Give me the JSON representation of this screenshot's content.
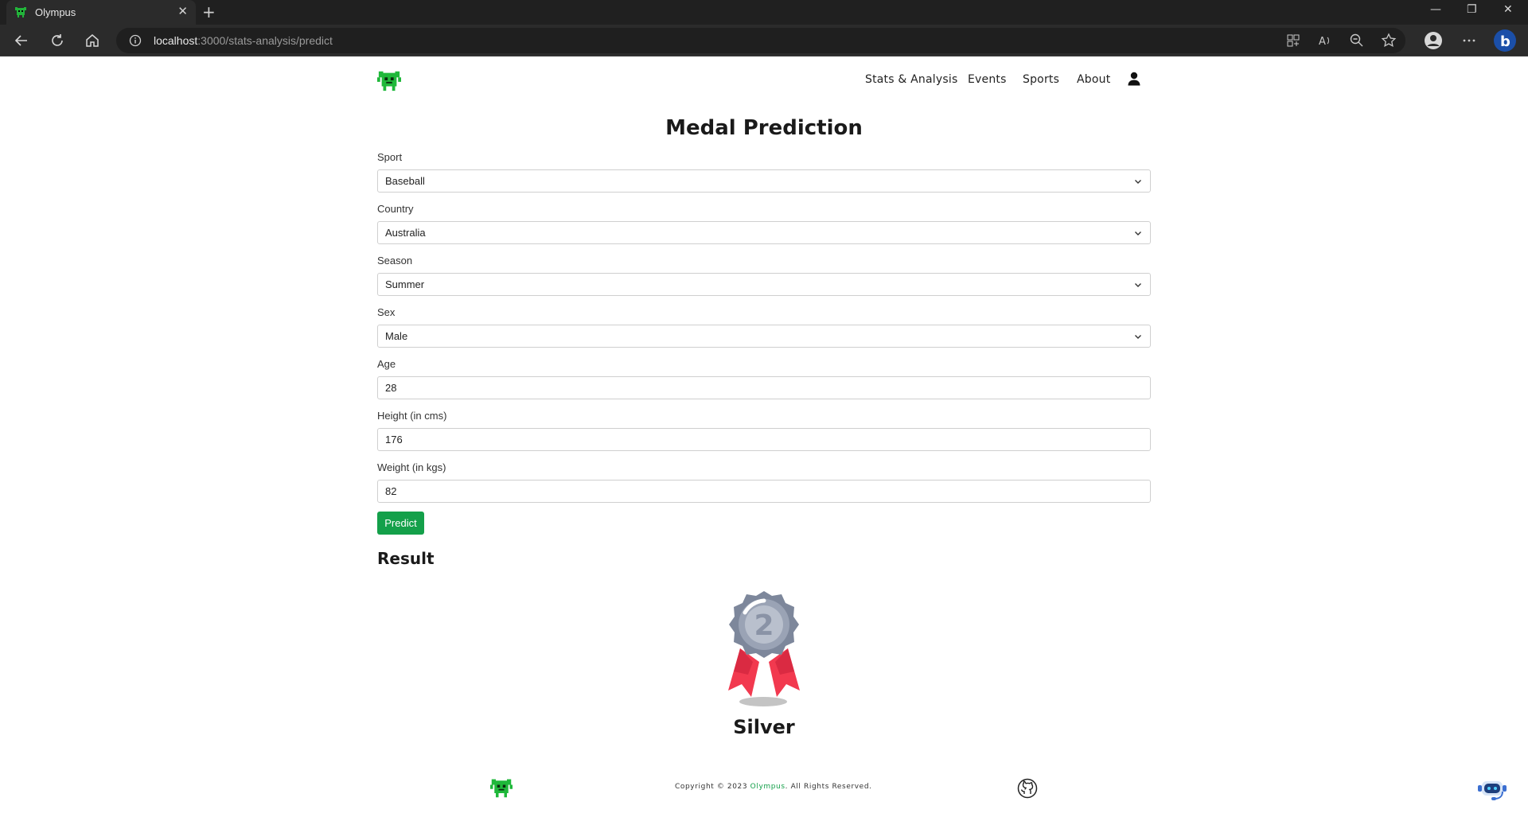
{
  "browser": {
    "tab_title": "Olympus",
    "url_host": "localhost",
    "url_path": ":3000/stats-analysis/predict"
  },
  "nav": {
    "items": [
      "Stats & Analysis",
      "Events",
      "Sports",
      "About"
    ]
  },
  "page_title": "Medal Prediction",
  "form": {
    "sport": {
      "label": "Sport",
      "value": "Baseball"
    },
    "country": {
      "label": "Country",
      "value": "Australia"
    },
    "season": {
      "label": "Season",
      "value": "Summer"
    },
    "sex": {
      "label": "Sex",
      "value": "Male"
    },
    "age": {
      "label": "Age",
      "value": "28"
    },
    "height": {
      "label": "Height (in cms)",
      "value": "176"
    },
    "weight": {
      "label": "Weight (in kgs)",
      "value": "82"
    },
    "predict_label": "Predict"
  },
  "result": {
    "heading": "Result",
    "medal_number": "2",
    "medal_name": "Silver"
  },
  "footer": {
    "copyright_prefix": "Copyright © 2023 ",
    "brand": "Olympus",
    "copyright_suffix": ". All Rights Reserved."
  },
  "colors": {
    "accent": "#14a04a",
    "medal_silver": "#8a93a6",
    "ribbon": "#f2394f"
  }
}
